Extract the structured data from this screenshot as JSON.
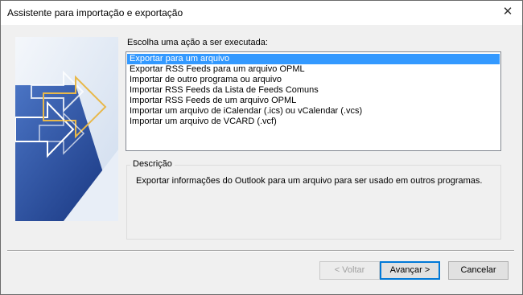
{
  "window": {
    "title": "Assistente para importação e exportação",
    "close_symbol": "✕"
  },
  "prompt": "Escolha uma ação a ser executada:",
  "actions": [
    "Exportar para um arquivo",
    "Exportar RSS Feeds para um arquivo OPML",
    "Importar de outro programa ou arquivo",
    "Importar RSS Feeds da Lista de Feeds Comuns",
    "Importar RSS Feeds de um arquivo OPML",
    "Importar um arquivo de iCalendar (.ics) ou vCalendar (.vcs)",
    "Importar um arquivo de VCARD (.vcf)"
  ],
  "selected_action": "Exportar para um arquivo",
  "description": {
    "title": "Descrição",
    "text": "Exportar informações do Outlook para um arquivo para ser usado em outros programas."
  },
  "buttons": {
    "back": "< Voltar",
    "next": "Avançar >",
    "cancel": "Cancelar"
  },
  "colors": {
    "selection": "#3399ff",
    "banner_dark": "#1e3c8c",
    "banner_light": "#dde8f5",
    "arrow_yellow": "#e8b84a"
  },
  "icons": {
    "close": "close-icon",
    "banner": "wizard-banner-arrows"
  }
}
